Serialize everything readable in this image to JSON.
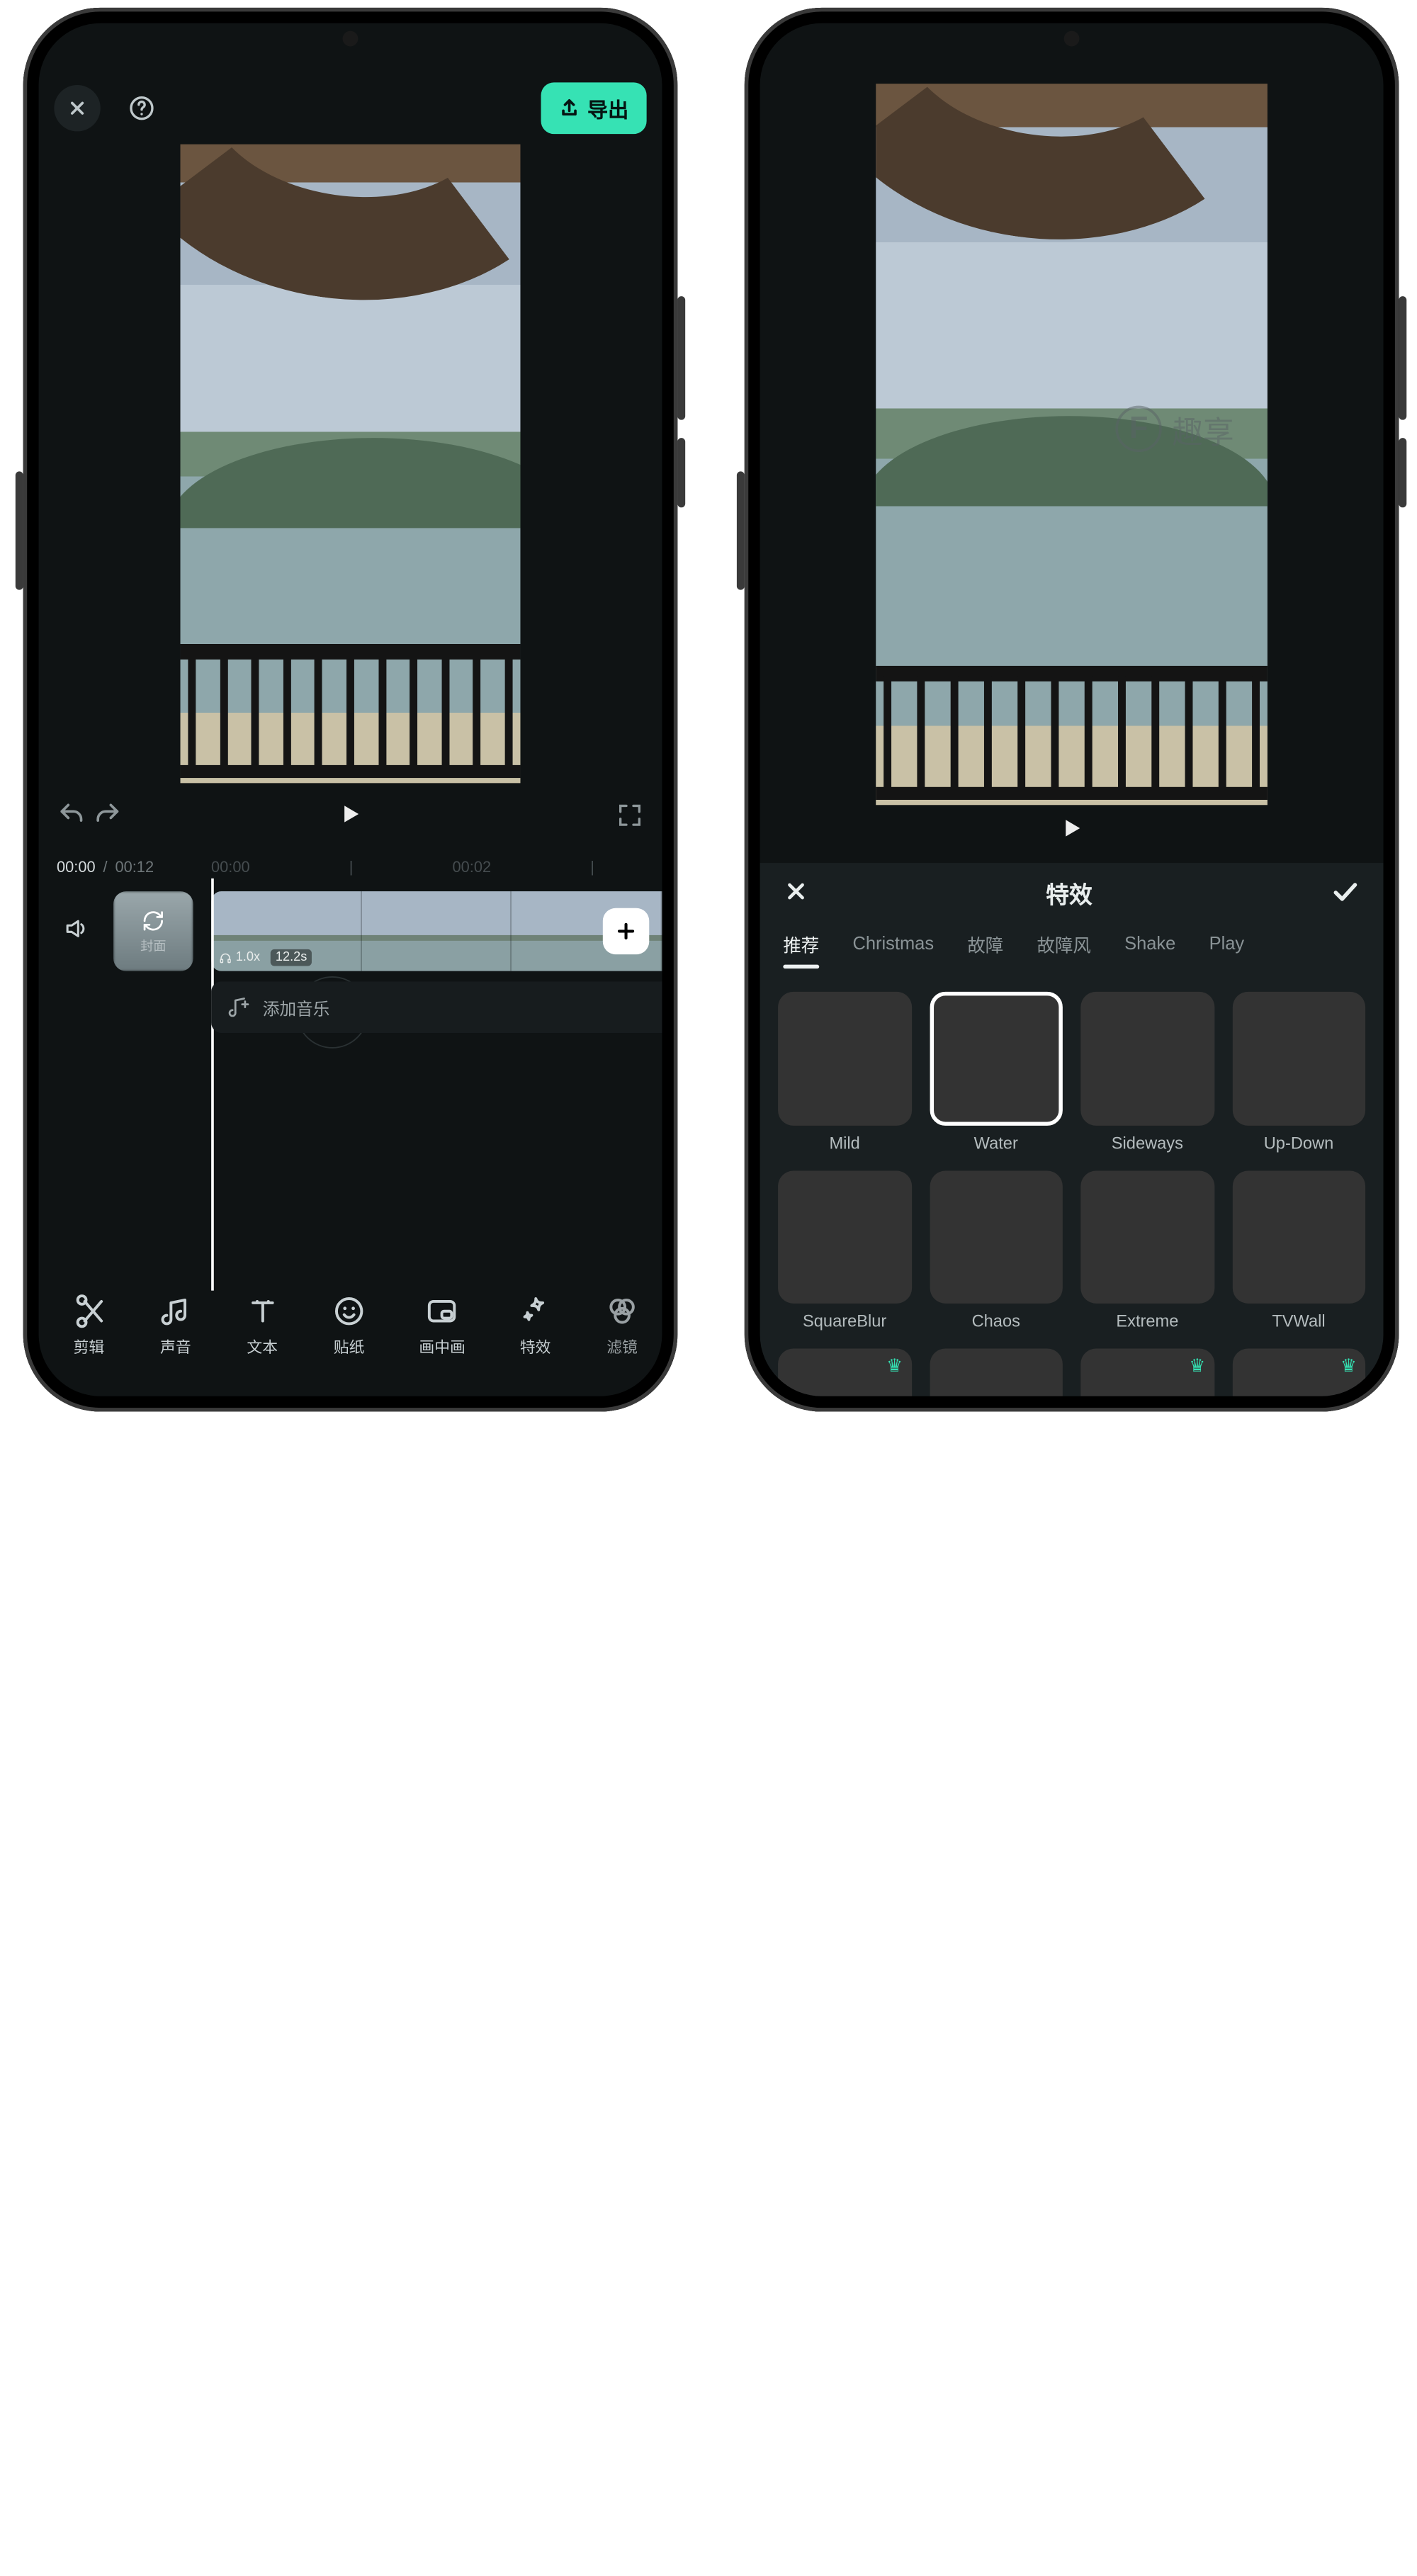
{
  "left": {
    "export_label": "导出",
    "time": {
      "current": "00:00",
      "total": "00:12"
    },
    "ticks": [
      "00:00",
      "|",
      "00:02",
      "|"
    ],
    "cover_label": "封面",
    "clip": {
      "speed": "1.0x",
      "duration": "12.2s"
    },
    "add_music_label": "添加音乐",
    "tools": [
      {
        "key": "cut",
        "label": "剪辑"
      },
      {
        "key": "audio",
        "label": "声音"
      },
      {
        "key": "text",
        "label": "文本"
      },
      {
        "key": "sticker",
        "label": "贴纸"
      },
      {
        "key": "pip",
        "label": "画中画"
      },
      {
        "key": "fx",
        "label": "特效"
      },
      {
        "key": "filter",
        "label": "滤镜"
      }
    ]
  },
  "right": {
    "watermark": "趣享",
    "panel_title": "特效",
    "tabs": [
      "推荐",
      "Christmas",
      "故障",
      "故障风",
      "Shake",
      "Play"
    ],
    "effects": [
      {
        "name": "Mild",
        "variant": "th-sunset",
        "selected": false
      },
      {
        "name": "Water",
        "variant": "th-shell",
        "selected": true
      },
      {
        "name": "Sideways",
        "variant": "th-sunset",
        "selected": false
      },
      {
        "name": "Up-Down",
        "variant": "th-cloud",
        "selected": false
      },
      {
        "name": "SquareBlur",
        "variant": "th-van",
        "selected": false
      },
      {
        "name": "Chaos",
        "variant": "th-surf",
        "selected": false
      },
      {
        "name": "Extreme",
        "variant": "th-surf",
        "selected": false
      },
      {
        "name": "TVWall",
        "variant": "th-grid",
        "selected": false
      },
      {
        "name": "",
        "variant": "th-people",
        "selected": false,
        "premium": true
      },
      {
        "name": "",
        "variant": "th-people",
        "selected": false
      },
      {
        "name": "",
        "variant": "th-crowd",
        "selected": false,
        "premium": true
      },
      {
        "name": "",
        "variant": "th-crowd",
        "selected": false,
        "premium": true
      }
    ]
  }
}
